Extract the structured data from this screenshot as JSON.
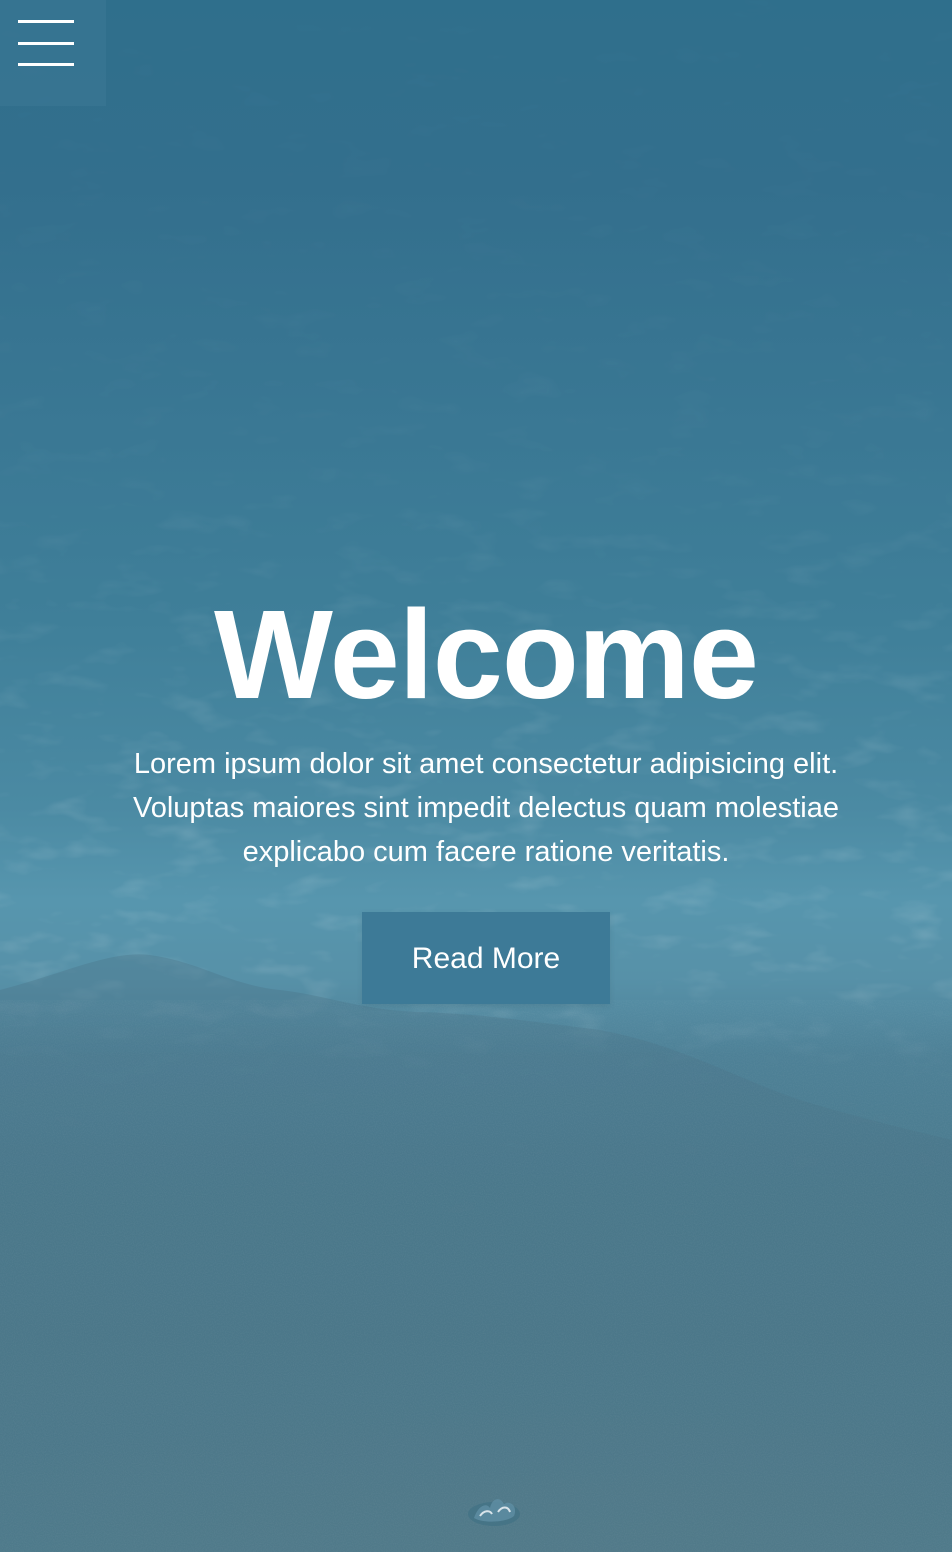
{
  "menu": {
    "icon": "hamburger-menu-icon"
  },
  "hero": {
    "title": "Welcome",
    "description": "Lorem ipsum dolor sit amet consectetur adipisicing elit. Voluptas maiores sint impedit delectus quam molestiae explicabo cum facere ratione veritatis.",
    "button_label": "Read More"
  },
  "colors": {
    "overlay": "#3d7a97",
    "text": "#ffffff"
  }
}
